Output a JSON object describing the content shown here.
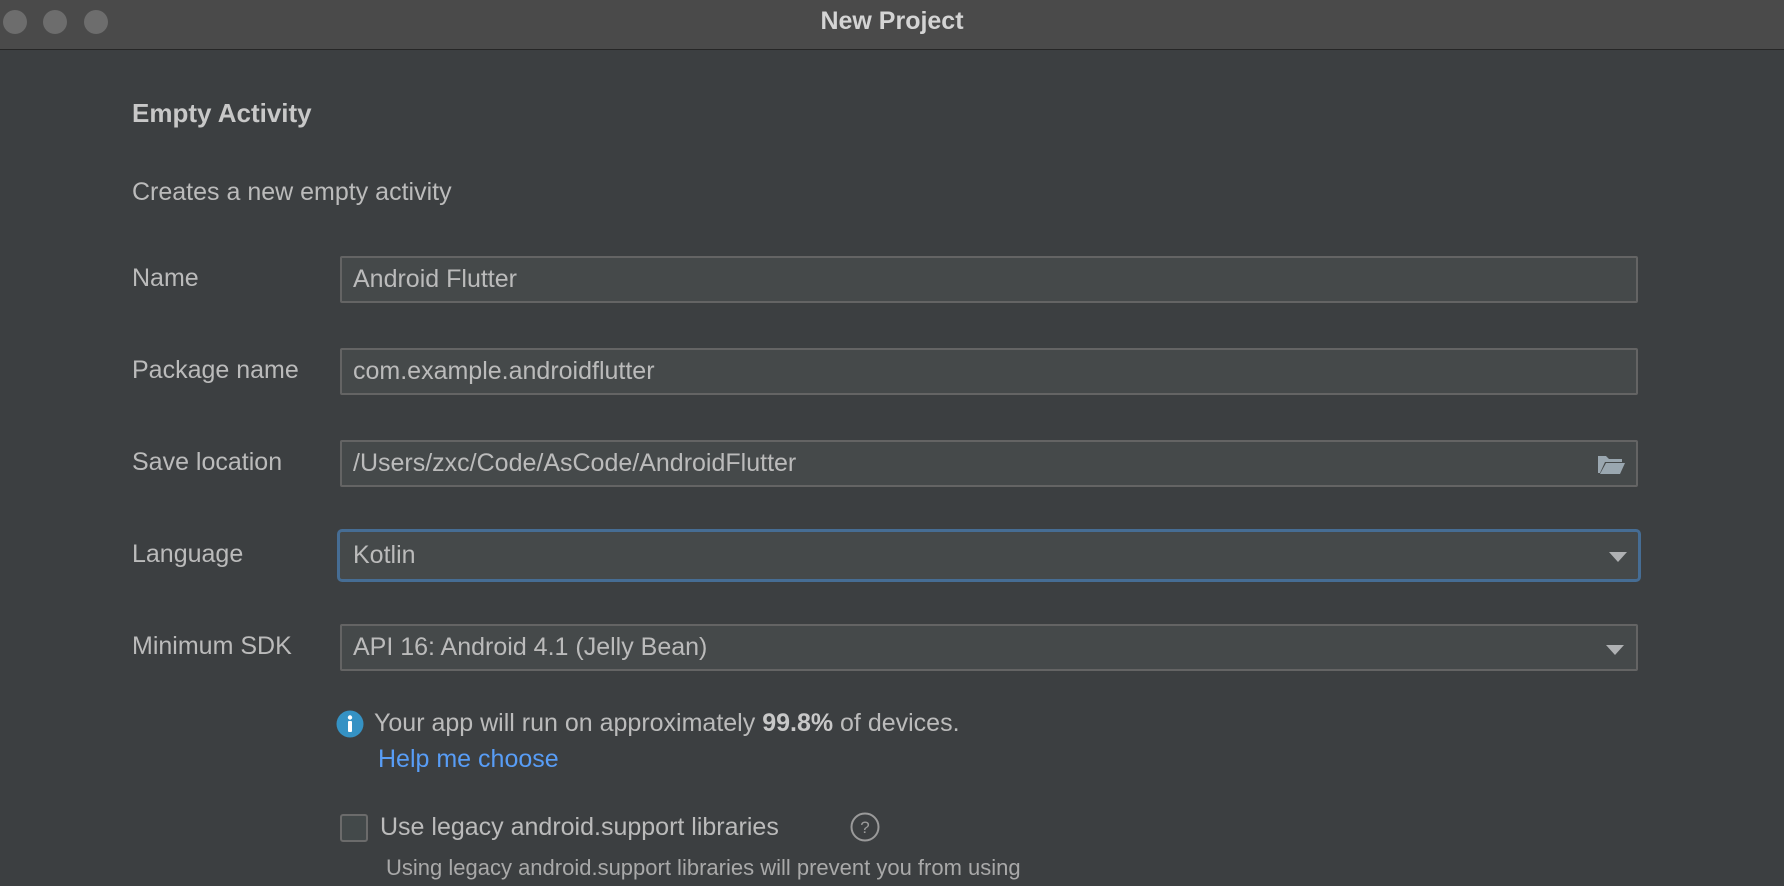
{
  "window": {
    "title": "New Project"
  },
  "template": {
    "heading": "Empty Activity",
    "description": "Creates a new empty activity"
  },
  "form": {
    "name": {
      "label": "Name",
      "value": "Android Flutter"
    },
    "package": {
      "label": "Package name",
      "value": "com.example.androidflutter"
    },
    "save_location": {
      "label": "Save location",
      "value": "/Users/zxc/Code/AsCode/AndroidFlutter",
      "icon": "folder-icon"
    },
    "language": {
      "label": "Language",
      "value": "Kotlin"
    },
    "min_sdk": {
      "label": "Minimum SDK",
      "value": "API 16: Android 4.1 (Jelly Bean)"
    }
  },
  "info": {
    "icon": "info-icon",
    "prefix": "Your app will run on approximately ",
    "percent": "99.8%",
    "suffix": " of devices.",
    "help_link": "Help me choose"
  },
  "legacy": {
    "checked": false,
    "label": "Use legacy android.support libraries",
    "icon": "question-icon",
    "note": "Using legacy android.support libraries will prevent you from using"
  },
  "colors": {
    "background": "#3c3f41",
    "field": "#45494a",
    "focus_border": "#466d94",
    "link": "#589df6",
    "info_icon": "#3592c4"
  }
}
